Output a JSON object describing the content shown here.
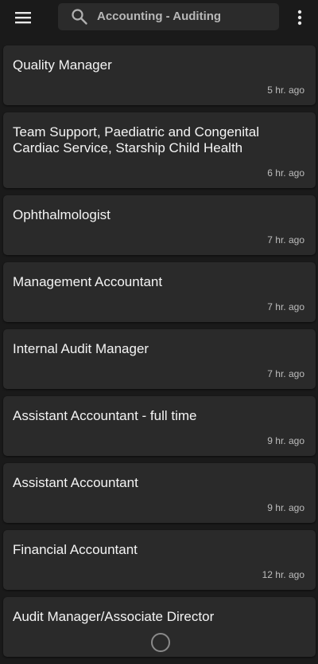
{
  "search": {
    "query": "Accounting - Auditing"
  },
  "jobs": [
    {
      "title": "Quality Manager",
      "time": "5 hr. ago"
    },
    {
      "title": "Team Support, Paediatric and Congenital Cardiac Service, Starship Child Health",
      "time": "6 hr. ago"
    },
    {
      "title": "Ophthalmologist",
      "time": "7 hr. ago"
    },
    {
      "title": "Management Accountant",
      "time": "7 hr. ago"
    },
    {
      "title": "Internal Audit Manager",
      "time": "7 hr. ago"
    },
    {
      "title": "Assistant Accountant - full time",
      "time": "9 hr. ago"
    },
    {
      "title": "Assistant Accountant",
      "time": "9 hr. ago"
    },
    {
      "title": "Financial Accountant",
      "time": "12 hr. ago"
    },
    {
      "title": "Audit Manager/Associate Director",
      "time": ""
    }
  ],
  "icons": {
    "menu": "menu-icon",
    "search": "search-icon",
    "more": "more-vert-icon"
  }
}
